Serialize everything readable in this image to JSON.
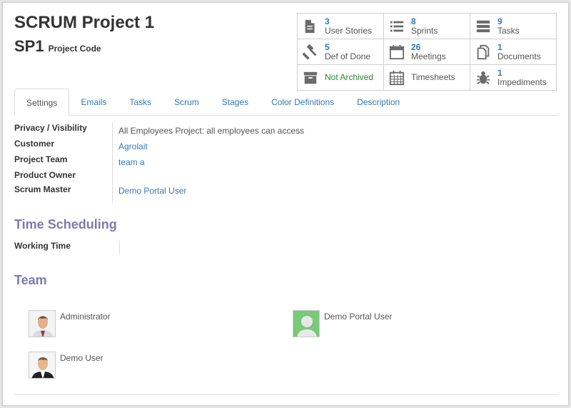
{
  "header": {
    "title": "SCRUM Project 1",
    "code": "SP1",
    "code_label": "Project Code"
  },
  "stats": [
    {
      "icon": "book-icon",
      "count": "3",
      "label": "User Stories"
    },
    {
      "icon": "list-icon",
      "count": "8",
      "label": "Sprints"
    },
    {
      "icon": "tasks-icon",
      "count": "9",
      "label": "Tasks"
    },
    {
      "icon": "gavel-icon",
      "count": "5",
      "label": "Def of Done"
    },
    {
      "icon": "calendar-icon",
      "count": "26",
      "label": "Meetings"
    },
    {
      "icon": "documents-icon",
      "count": "1",
      "label": "Documents"
    },
    {
      "icon": "archive-icon",
      "count": "",
      "label": "Not Archived"
    },
    {
      "icon": "timesheet-icon",
      "count": "",
      "label": "Timesheets"
    },
    {
      "icon": "bug-icon",
      "count": "1",
      "label": "Impediments"
    }
  ],
  "tabs": [
    "Settings",
    "Emails",
    "Tasks",
    "Scrum",
    "Stages",
    "Color Definitions",
    "Description"
  ],
  "fields": {
    "privacy_label": "Privacy / Visibility",
    "privacy_value": "All Employees Project: all employees can access",
    "customer_label": "Customer",
    "customer_value": "Agrolait",
    "team_label": "Project Team",
    "team_value": "team a",
    "owner_label": "Product Owner",
    "owner_value": "",
    "master_label": "Scrum Master",
    "master_value": "Demo Portal User"
  },
  "time_scheduling": {
    "heading": "Time Scheduling",
    "working_time_label": "Working Time",
    "working_time_value": ""
  },
  "team": {
    "heading": "Team",
    "members": [
      "Administrator",
      "Demo Portal User",
      "Demo User"
    ]
  },
  "colors": {
    "link": "#337ab7",
    "section": "#7c7bad",
    "archived_green": "#2a8a2a"
  }
}
